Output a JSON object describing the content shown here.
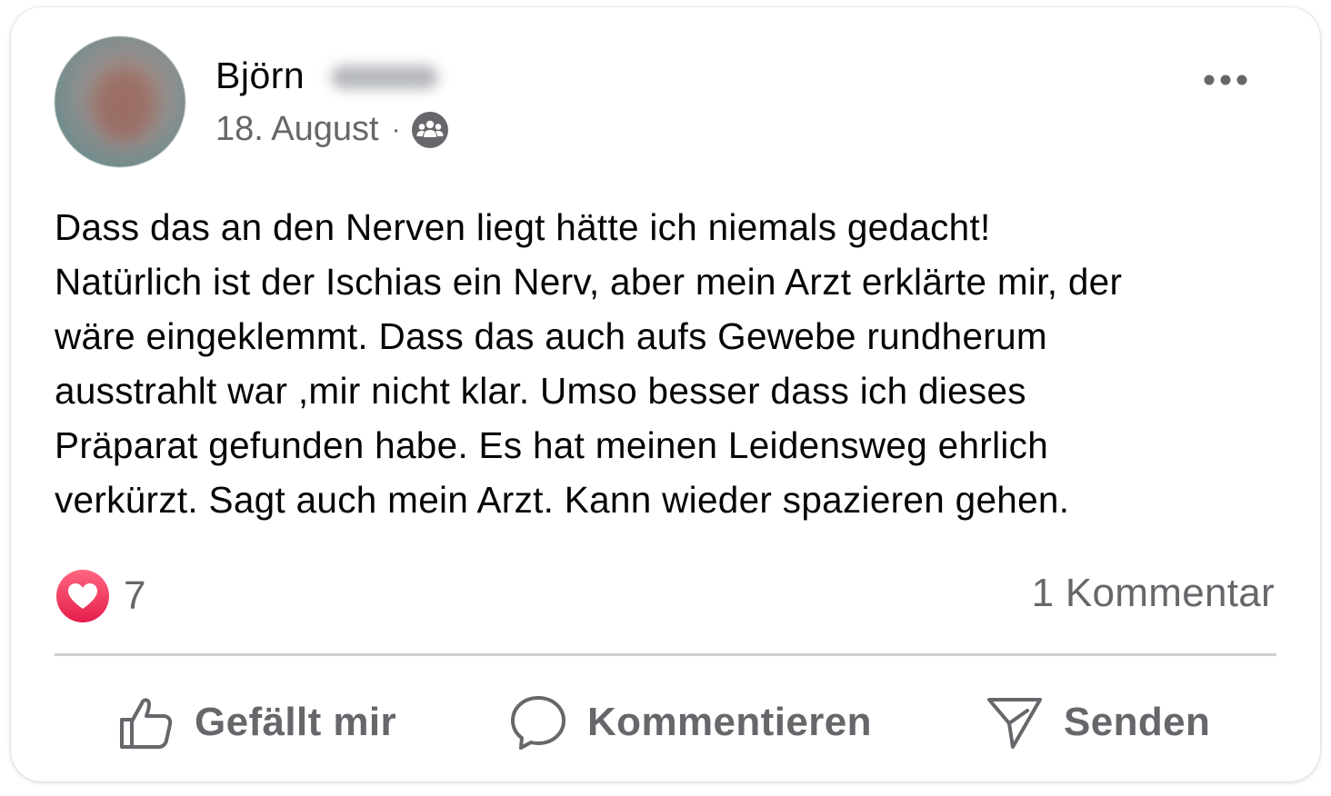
{
  "post": {
    "author_name": "Björn",
    "date": "18. August",
    "separator": "·",
    "audience_icon": "group-icon",
    "more_icon": "more-horizontal-icon",
    "text": "Dass das an den Nerven liegt hätte ich niemals gedacht!\nNatürlich ist der Ischias ein Nerv, aber mein Arzt erklärte mir, der\nwäre eingeklemmt. Dass das auch aufs Gewebe rundherum\nausstrahlt war ,mir nicht klar. Umso besser dass ich dieses\nPräparat gefunden habe. Es hat meinen Leidensweg ehrlich\nverkürzt. Sagt auch mein Arzt. Kann wieder spazieren gehen."
  },
  "stats": {
    "reaction_icon": "heart-icon",
    "reaction_count": "7",
    "comment_count": "1 Kommentar"
  },
  "actions": {
    "like_label": "Gefällt mir",
    "like_icon": "thumbs-up-icon",
    "comment_label": "Kommentieren",
    "comment_icon": "comment-bubble-icon",
    "share_label": "Senden",
    "share_icon": "send-icon"
  },
  "colors": {
    "text_primary": "#050505",
    "text_secondary": "#65676b",
    "divider": "#ced0d4",
    "love_red": "#f0284a"
  }
}
